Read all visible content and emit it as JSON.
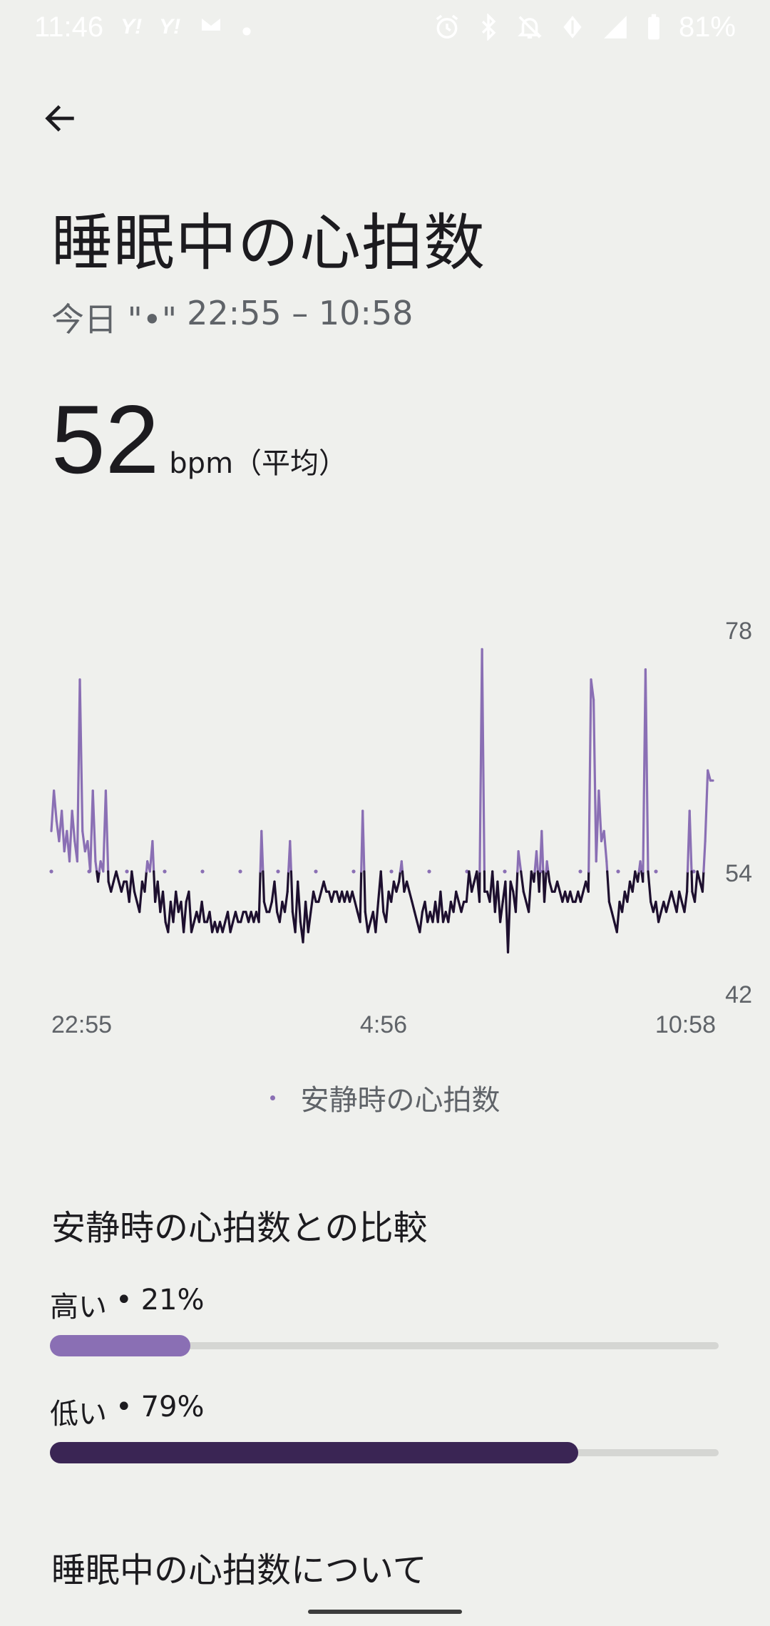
{
  "status_bar": {
    "time": "11:46",
    "notification_icons": [
      "Y!",
      "Y!"
    ],
    "battery": "81%"
  },
  "header": {
    "title": "睡眠中の心拍数",
    "date_label": "今日 \"•\"",
    "time_range": "22:55 – 10:58"
  },
  "summary": {
    "value": "52",
    "unit": "bpm（平均）"
  },
  "chart_data": {
    "type": "line",
    "x_ticks": [
      "22:55",
      "4:56",
      "10:58"
    ],
    "y_ticks": [
      78,
      54,
      42
    ],
    "ylim": [
      42,
      78
    ],
    "resting_heart_rate": 54,
    "series": [
      {
        "color": "#1d0f2e",
        "values": [
          58,
          62,
          59,
          57,
          60,
          56,
          58,
          55,
          60,
          57,
          55,
          73,
          58,
          56,
          57,
          54,
          62,
          55,
          53,
          55,
          54,
          62,
          53,
          52,
          53,
          54,
          53,
          52,
          53,
          53,
          51,
          54,
          52,
          51,
          50,
          53,
          52,
          55,
          54,
          57,
          51,
          53,
          50,
          52,
          49,
          48,
          51,
          49,
          52,
          50,
          51,
          48,
          51,
          52,
          48,
          49,
          50,
          49,
          51,
          49,
          49,
          50,
          48,
          49,
          48,
          49,
          48,
          49,
          50,
          48,
          49,
          50,
          49,
          49,
          50,
          50,
          49,
          50,
          49,
          50,
          49,
          58,
          51,
          50,
          50,
          51,
          53,
          50,
          49,
          51,
          50,
          52,
          57,
          50,
          48,
          53,
          49,
          47,
          51,
          48,
          50,
          52,
          51,
          51,
          52,
          53,
          52,
          52,
          51,
          52,
          52,
          51,
          52,
          51,
          52,
          51,
          52,
          51,
          50,
          49,
          60,
          50,
          48,
          49,
          50,
          48,
          51,
          54,
          50,
          49,
          52,
          51,
          53,
          52,
          53,
          55,
          52,
          53,
          52,
          51,
          50,
          49,
          48,
          50,
          51,
          49,
          50,
          49,
          51,
          49,
          52,
          49,
          50,
          49,
          51,
          50,
          52,
          51,
          50,
          51,
          51,
          54,
          52,
          53,
          54,
          51,
          76,
          52,
          52,
          51,
          54,
          50,
          53,
          49,
          51,
          53,
          46,
          53,
          52,
          50,
          56,
          54,
          52,
          51,
          50,
          54,
          53,
          56,
          52,
          58,
          51,
          55,
          53,
          52,
          52,
          53,
          52,
          51,
          52,
          51,
          52,
          51,
          51,
          52,
          51,
          52,
          53,
          52,
          73,
          71,
          55,
          62,
          57,
          58,
          55,
          51,
          50,
          49,
          48,
          51,
          50,
          52,
          51,
          53,
          52,
          54,
          53,
          55,
          53,
          74,
          54,
          51,
          50,
          51,
          49,
          50,
          51,
          50,
          51,
          52,
          51,
          50,
          52,
          51,
          50,
          52,
          60,
          52,
          51,
          54,
          53,
          52,
          57,
          64,
          63,
          63
        ]
      }
    ]
  },
  "legend": {
    "label": "安静時の心拍数",
    "dot_color": "#8a6fb4"
  },
  "comparison": {
    "title": "安静時の心拍数との比較",
    "high": {
      "label": "高い",
      "sep": "•",
      "percent": "21%",
      "fraction": 0.21,
      "color": "#8a6fb4"
    },
    "low": {
      "label": "低い",
      "sep": "•",
      "percent": "79%",
      "fraction": 0.79,
      "color": "#3a2554"
    }
  },
  "about": {
    "title": "睡眠中の心拍数について"
  },
  "colors": {
    "above_resting": "#8a6fb4",
    "below_resting": "#1d0f2e",
    "background": "#eff0ed"
  }
}
